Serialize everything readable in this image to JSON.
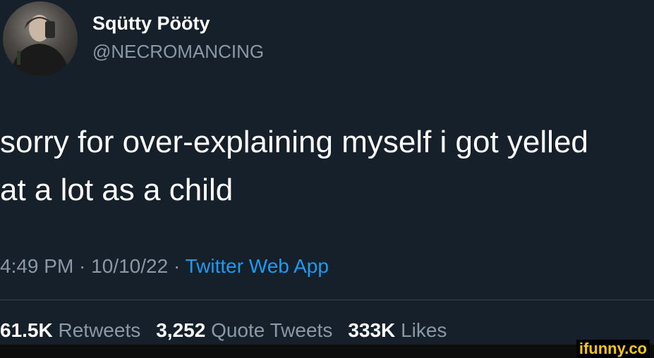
{
  "tweet": {
    "display_name": "Sqütty Pööty",
    "handle": "@NECROMANCING",
    "text": "sorry for over-explaining myself i got yelled\nat a lot as a child",
    "time": "4:49 PM",
    "date": "10/10/22",
    "separator": " · ",
    "source": "Twitter Web App",
    "stats": {
      "retweets_count": "61.5K",
      "retweets_label": "Retweets",
      "quotes_count": "3,252",
      "quotes_label": "Quote Tweets",
      "likes_count": "333K",
      "likes_label": "Likes"
    }
  },
  "watermark": "ifunny.co",
  "colors": {
    "background": "#15202b",
    "secondary_text": "#8b98a5",
    "accent": "#1d9bf0",
    "watermark": "#f5c518"
  }
}
